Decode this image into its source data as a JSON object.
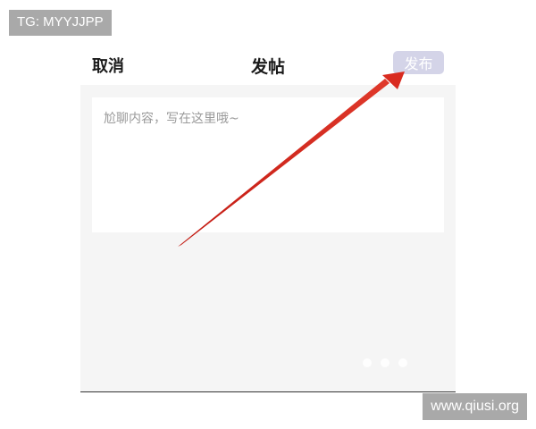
{
  "watermarks": {
    "top": "TG: MYYJJPP",
    "bottom": "www.qiusi.org"
  },
  "header": {
    "cancel_label": "取消",
    "title": "发帖",
    "publish_label": "发布"
  },
  "editor": {
    "placeholder": "尬聊内容，写在这里哦~"
  },
  "colors": {
    "publish_button_bg": "#d4d4e8",
    "content_bg": "#f5f5f5",
    "arrow": "#d92b20"
  }
}
